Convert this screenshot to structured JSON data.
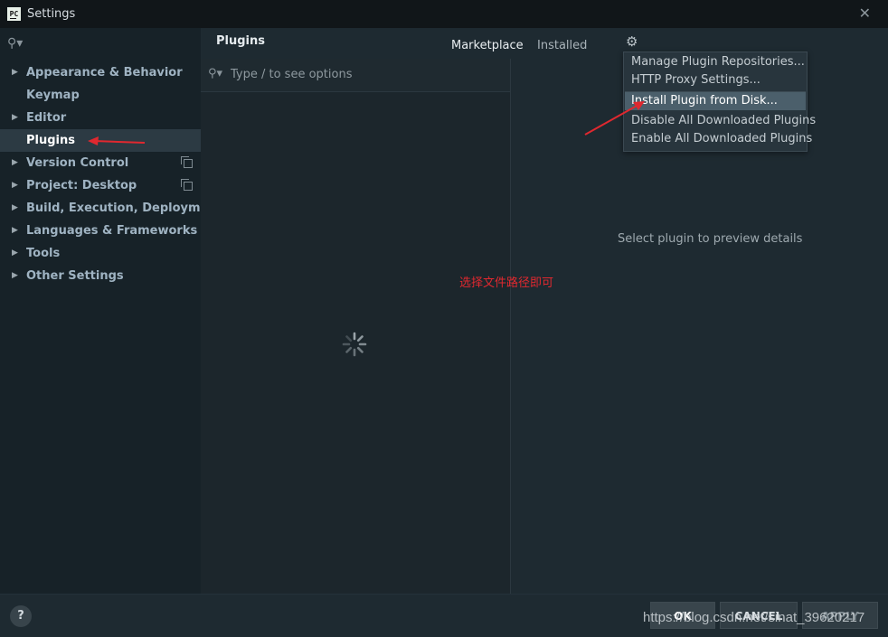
{
  "window": {
    "logo_text": "PC",
    "title": "Settings"
  },
  "sidebar": {
    "items": [
      {
        "label": "Appearance & Behavior",
        "expandable": true
      },
      {
        "label": "Keymap",
        "expandable": false
      },
      {
        "label": "Editor",
        "expandable": true
      },
      {
        "label": "Plugins",
        "expandable": false,
        "selected": true
      },
      {
        "label": "Version Control",
        "expandable": true,
        "copy_icon": true
      },
      {
        "label": "Project: Desktop",
        "expandable": true,
        "copy_icon": true
      },
      {
        "label": "Build, Execution, Deployment",
        "expandable": true
      },
      {
        "label": "Languages & Frameworks",
        "expandable": true
      },
      {
        "label": "Tools",
        "expandable": true
      },
      {
        "label": "Other Settings",
        "expandable": true
      }
    ]
  },
  "main": {
    "title": "Plugins",
    "tabs": {
      "marketplace": "Marketplace",
      "installed": "Installed"
    },
    "search_placeholder": "Type / to see options",
    "preview_message": "Select plugin to preview details"
  },
  "gear_menu": {
    "items": [
      "Manage Plugin Repositories...",
      "HTTP Proxy Settings...",
      "Install Plugin from Disk...",
      "Disable All Downloaded Plugins",
      "Enable All Downloaded Plugins"
    ],
    "highlighted": "Install Plugin from Disk..."
  },
  "annotation": {
    "text": "选择文件路径即可",
    "color": "#e0282f"
  },
  "footer": {
    "help": "?",
    "ok": "OK",
    "cancel": "CANCEL",
    "apply": "APPLY"
  },
  "watermark": "https://blog.csdn.net/sinat_39620217",
  "colors": {
    "selected_item_bg": "#2c3a43",
    "menu_highlight": "#4b5f6b",
    "annotation_arrow": "#e0282f"
  }
}
